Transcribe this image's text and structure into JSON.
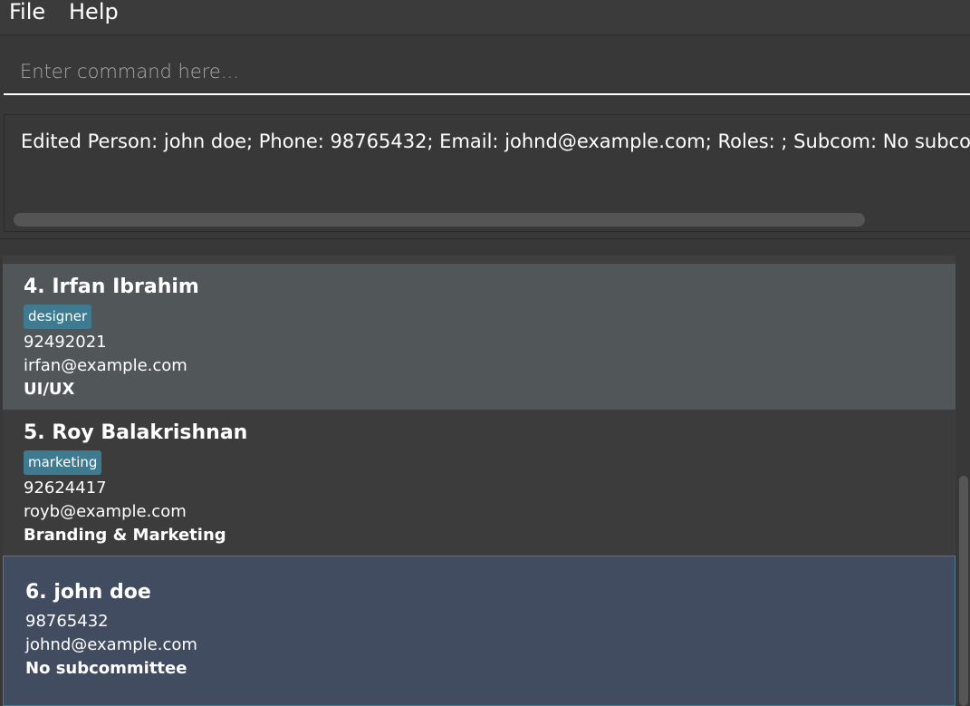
{
  "menu": {
    "file_label": "File",
    "help_label": "Help"
  },
  "command": {
    "placeholder": "Enter command here...",
    "value": ""
  },
  "result": {
    "text": "Edited Person: john doe; Phone: 98765432; Email: johnd@example.com; Roles: ; Subcom: No subcommittee"
  },
  "persons": [
    {
      "name": "4. Irfan Ibrahim",
      "tag": "designer",
      "phone": "92492021",
      "email": "irfan@example.com",
      "subcommittee": "UI/UX"
    },
    {
      "name": "5. Roy Balakrishnan",
      "tag": "marketing",
      "phone": "92624417",
      "email": "royb@example.com",
      "subcommittee": "Branding & Marketing"
    },
    {
      "name": "6. john doe",
      "phone": "98765432",
      "email": "johnd@example.com",
      "subcommittee": "No subcommittee"
    }
  ],
  "colors": {
    "background": "#383838",
    "tag": "#3e7b91",
    "card_selected": "#515658",
    "card_last": "#424c60"
  }
}
